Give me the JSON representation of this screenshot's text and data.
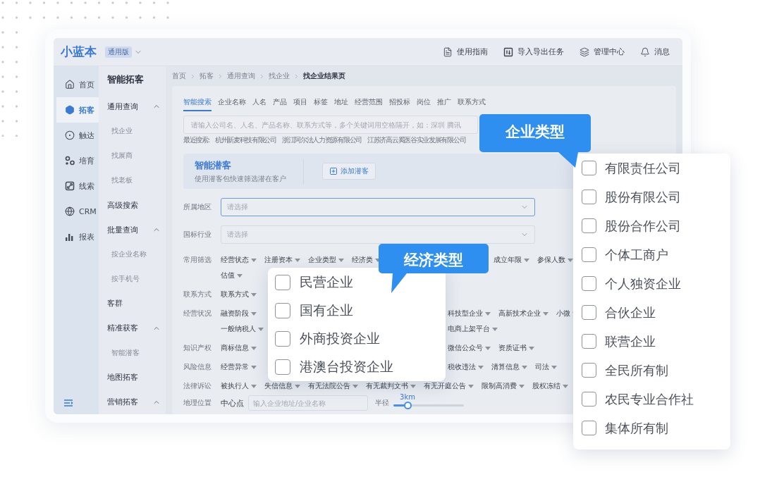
{
  "header": {
    "logo": "小蓝本",
    "edition": "通用版",
    "actions": [
      {
        "kind": "guide",
        "label": "使用指南"
      },
      {
        "kind": "tasks",
        "label": "导入导出任务"
      },
      {
        "kind": "admin",
        "label": "管理中心"
      },
      {
        "kind": "bell",
        "label": "消息"
      }
    ]
  },
  "rail": {
    "items": [
      {
        "kind": "home",
        "label": "首页",
        "selected": false
      },
      {
        "kind": "hexagon",
        "label": "拓客",
        "selected": true
      },
      {
        "kind": "target",
        "label": "触达",
        "selected": false
      },
      {
        "kind": "nodes",
        "label": "培育",
        "selected": false
      },
      {
        "kind": "clue",
        "label": "线索",
        "selected": false
      },
      {
        "kind": "globe",
        "label": "CRM",
        "selected": false
      },
      {
        "kind": "chart",
        "label": "报表",
        "selected": false
      }
    ]
  },
  "nav": {
    "title": "智能拓客",
    "items": [
      {
        "label": "通用查询",
        "expanded": true,
        "children": [
          {
            "label": "找企业"
          },
          {
            "label": "找展商"
          },
          {
            "label": "找老板"
          }
        ]
      },
      {
        "label": "高级搜索"
      },
      {
        "label": "批量查询",
        "expanded": true,
        "children": [
          {
            "label": "按企业名称"
          },
          {
            "label": "按手机号"
          }
        ]
      },
      {
        "label": "客群"
      },
      {
        "label": "精准获客",
        "expanded": true,
        "children": [
          {
            "label": "智能潜客"
          }
        ]
      },
      {
        "label": "地图拓客"
      },
      {
        "label": "营销拓客",
        "expanded": true
      }
    ]
  },
  "breadcrumb": [
    "首页",
    "拓客",
    "通用查询",
    "找企业",
    "找企业结果页"
  ],
  "search": {
    "tabs": [
      {
        "label": "智能搜索",
        "selected": true
      },
      {
        "label": "企业名称",
        "selected": false
      },
      {
        "label": "人名",
        "selected": false
      },
      {
        "label": "产品",
        "selected": false
      },
      {
        "label": "项目",
        "selected": false
      },
      {
        "label": "标签",
        "selected": false
      },
      {
        "label": "地址",
        "selected": false
      },
      {
        "label": "经营范围",
        "selected": false
      },
      {
        "label": "招投标",
        "selected": false
      },
      {
        "label": "岗位",
        "selected": false
      },
      {
        "label": "推广",
        "selected": false
      },
      {
        "label": "联系方式",
        "selected": false
      }
    ],
    "placeholder": "请输入公司名、人名、产品名称、联系方式等，多个关键词用空格隔开，如：深圳 腾讯",
    "recent_label": "最近搜索:",
    "recent": [
      "杭州新麦科技有限公司",
      "浙江阿尔法人力资源有限公司",
      "江苏济高云奚医谷实业发展有限公司"
    ]
  },
  "banner": {
    "title": "智能潜客",
    "subtitle": "使用潜客包快速筛选潜在客户",
    "button": "添加潜客"
  },
  "fields": [
    {
      "label": "所属地区",
      "placeholder": "请选择",
      "focused": true
    },
    {
      "label": "国标行业",
      "placeholder": "请选择",
      "focused": false
    }
  ],
  "filters": [
    {
      "label": "常用筛选",
      "lines": [
        {
          "left": [
            "经营状态",
            "注册资本",
            "企业类型",
            "经济类"
          ],
          "right": [
            "成立年限",
            "参保人数"
          ]
        },
        {
          "left": [
            "估值"
          ]
        }
      ]
    },
    {
      "label": "联系方式",
      "lines": [
        {
          "left": [
            "联系方式"
          ]
        }
      ]
    },
    {
      "label": "经营状况",
      "lines": [
        {
          "left": [
            "融资阶段"
          ],
          "right": [
            "科技型企业",
            "高新技术企业",
            "小微"
          ]
        },
        {
          "left": [
            "一般纳税人"
          ],
          "right": [
            "电商上架平台"
          ]
        }
      ]
    },
    {
      "label": "知识产权",
      "lines": [
        {
          "left": [
            "商标信息"
          ],
          "right": [
            "微信公众号",
            "资质证书"
          ]
        }
      ]
    },
    {
      "label": "风险信息",
      "lines": [
        {
          "left": [
            "经营异常"
          ],
          "right": [
            "税收违法",
            "清算信息",
            "司法"
          ]
        }
      ]
    },
    {
      "label": "法律诉讼",
      "lines": [
        {
          "left": [
            "被执行人",
            "失信信息",
            "有无法院公告",
            "有无裁判文书",
            "有无开庭公告",
            "限制高消费",
            "股权冻结"
          ]
        }
      ]
    }
  ],
  "geo": {
    "label": "地理位置",
    "center_label": "中心点",
    "placeholder": "输入企业地址/企业名称",
    "radius_label": "半径",
    "radius": "3km",
    "level": 0.2
  },
  "economic_type": {
    "title": "经济类型",
    "options": [
      {
        "label": "民营企业",
        "checked": false
      },
      {
        "label": "国有企业",
        "checked": false
      },
      {
        "label": "外商投资企业",
        "checked": false
      },
      {
        "label": "港澳台投资企业",
        "checked": false
      }
    ]
  },
  "company_type": {
    "title": "企业类型",
    "options": [
      {
        "label": "有限责任公司",
        "checked": false
      },
      {
        "label": "股份有限公司",
        "checked": false
      },
      {
        "label": "股份合作公司",
        "checked": false
      },
      {
        "label": "个体工商户",
        "checked": false
      },
      {
        "label": "个人独资企业",
        "checked": false
      },
      {
        "label": "合伙企业",
        "checked": false
      },
      {
        "label": "联营企业",
        "checked": false
      },
      {
        "label": "全民所有制",
        "checked": false
      },
      {
        "label": "农民专业合作社",
        "checked": false
      },
      {
        "label": "集体所有制",
        "checked": false
      }
    ]
  }
}
